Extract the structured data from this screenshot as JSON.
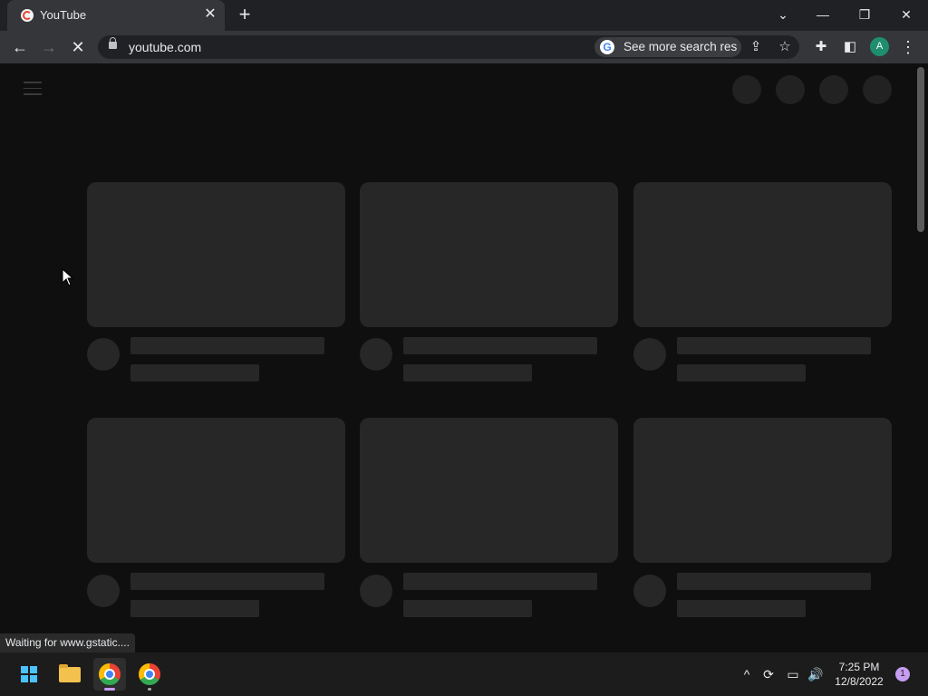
{
  "tab": {
    "title": "YouTube",
    "close_glyph": "✕",
    "favicon": "youtube-icon"
  },
  "new_tab_glyph": "+",
  "window_controls": {
    "tab_search": "⌄",
    "minimize": "—",
    "restore": "❐",
    "close": "✕"
  },
  "toolbar": {
    "back": "←",
    "forward": "→",
    "stop": "✕"
  },
  "omnibox": {
    "url": "youtube.com",
    "chip_text": "See more search res",
    "chip_logo": "G"
  },
  "toolbar_right": {
    "share": "⇪",
    "bookmark": "☆",
    "extensions": "✚",
    "sidepanel": "◧",
    "avatar_letter": "A",
    "menu": "⋮"
  },
  "status": {
    "text": "Waiting for www.gstatic...."
  },
  "taskbar": {
    "time": "7:25 PM",
    "date": "12/8/2022",
    "notification_count": "1",
    "tray": {
      "chevron": "^",
      "sync": "⟳",
      "network": "▭",
      "volume": "🔊"
    }
  },
  "colors": {
    "accent": "#4cc2ff",
    "skeleton": "#272727",
    "avatar": "#1e8e6e"
  }
}
